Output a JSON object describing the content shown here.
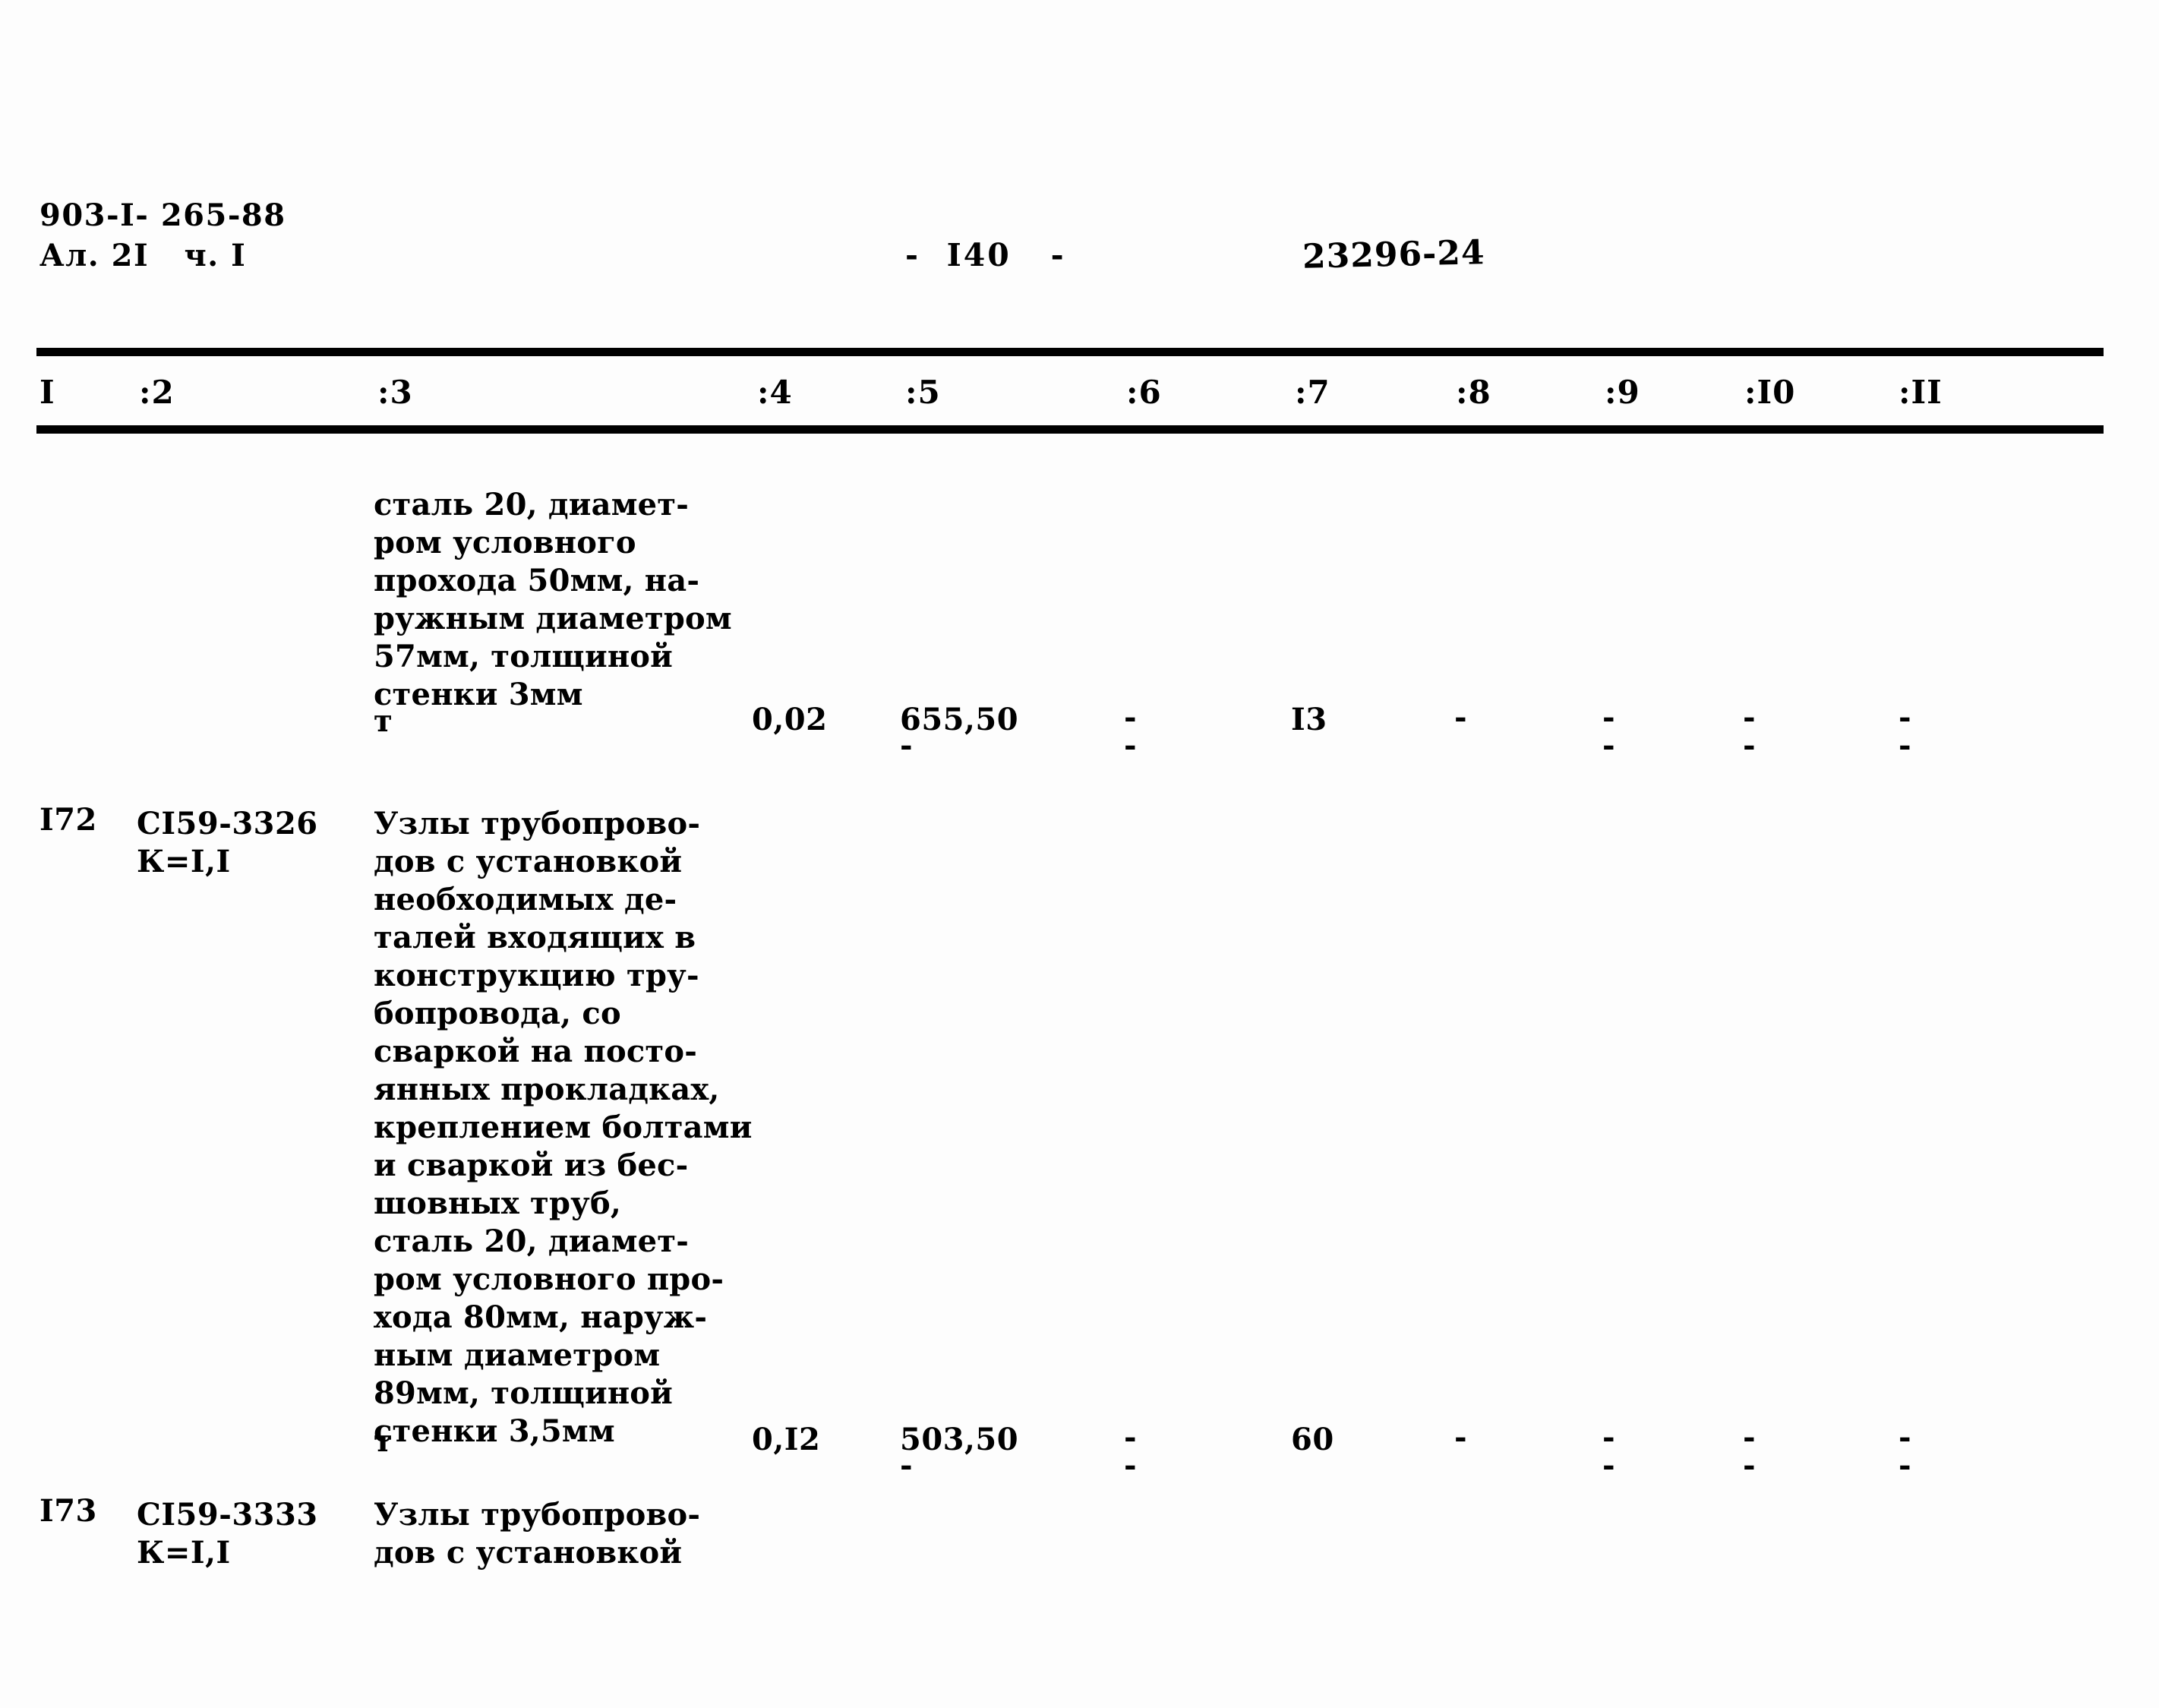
{
  "header": {
    "doc_code_line1": "903-I- 265-88",
    "doc_code_line2": "Ал. 2I   ч. I",
    "page_number": "-  I40   -",
    "stamp_number": "23296-24"
  },
  "table": {
    "column_headers": [
      "I",
      ":2",
      ":3",
      ":4",
      ":5",
      ":6",
      ":7",
      ":8",
      ":9",
      ":I0",
      ":II"
    ],
    "rows": [
      {
        "num": "",
        "code": "",
        "description": "сталь 20, диамет-\nром условного\nпрохода 50мм, на-\nружным диаметром\n57мм, толщиной\nстенки 3мм",
        "unit": "т",
        "c4": "0,02",
        "c5": "655,50",
        "c6": "-",
        "c7": "I3",
        "c8": "-",
        "c9": "-",
        "c10": "-",
        "c11": "-"
      },
      {
        "num": "I72",
        "code": "CI59-3326\nК=I,I",
        "description": "Узлы трубопрово-\nдов с установкой\nнеобходимых де-\nталей входящих в\nконструкцию тру-\nбопровода, со\nсваркой на посто-\nянных прокладках,\nкреплением болтами\nи сваркой из бес-\nшовных труб,\nсталь 20, диамет-\nром условного про-\nхода 80мм, наруж-\nным диаметром\n89мм, толщиной\nстенки 3,5мм",
        "unit": "т",
        "c4": "0,I2",
        "c5": "503,50",
        "c6": "-",
        "c7": "60",
        "c8": "-",
        "c9": "-",
        "c10": "-",
        "c11": "-"
      },
      {
        "num": "I73",
        "code": "CI59-3333\nК=I,I",
        "description": "Узлы трубопрово-\nдов с установкой",
        "unit": "",
        "c4": "",
        "c5": "",
        "c6": "",
        "c7": "",
        "c8": "",
        "c9": "",
        "c10": "",
        "c11": ""
      }
    ]
  }
}
